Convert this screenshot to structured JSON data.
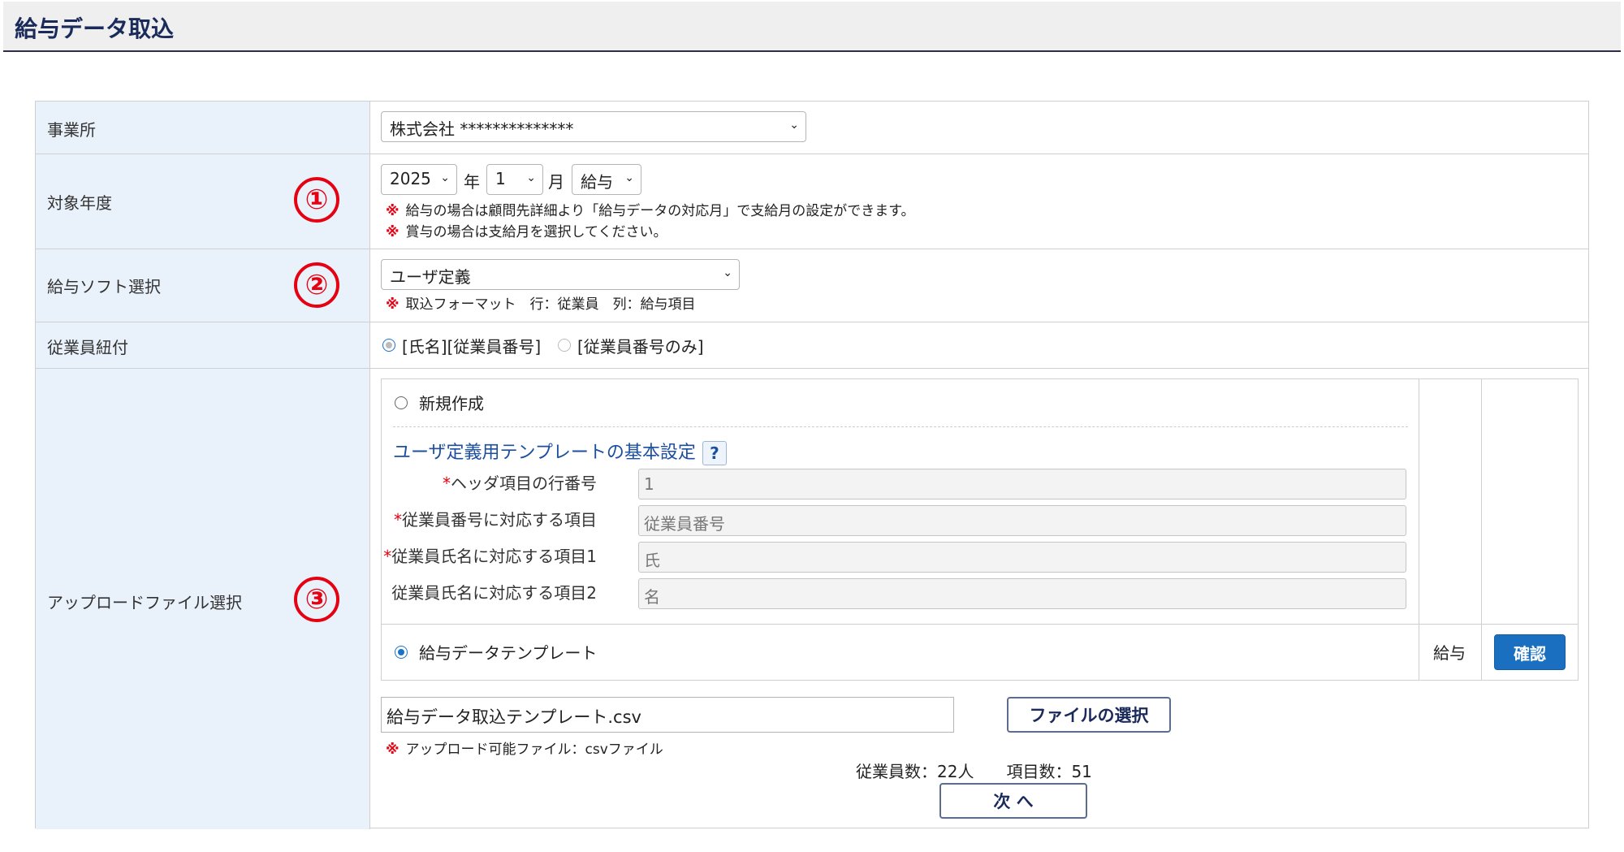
{
  "page": {
    "title": "給与データ取込"
  },
  "office": {
    "label": "事業所",
    "value": "株式会社 **************"
  },
  "year": {
    "label": "対象年度",
    "marker": "①",
    "year_value": "2025",
    "year_unit": "年",
    "month_value": "1",
    "month_unit": "月",
    "type_value": "給与",
    "notes": [
      "給与の場合は顧問先詳細より「給与データの対応月」で支給月の設定ができます。",
      "賞与の場合は支給月を選択してください。"
    ],
    "note_mark": "※"
  },
  "software": {
    "label": "給与ソフト選択",
    "marker": "②",
    "value": "ユーザ定義",
    "note": "取込フォーマット　行：従業員　列：給与項目",
    "note_mark": "※"
  },
  "employee_link": {
    "label": "従業員紐付",
    "option1": "[氏名][従業員番号]",
    "option2": "[従業員番号のみ]"
  },
  "upload": {
    "label": "アップロードファイル選択",
    "marker": "③",
    "new_label": "新規作成",
    "template_section_title": "ユーザ定義用テンプレートの基本設定",
    "help_label": "?",
    "required_mark": "*",
    "fields": [
      {
        "label": "ヘッダ項目の行番号",
        "value": "1",
        "required": true
      },
      {
        "label": "従業員番号に対応する項目",
        "value": "従業員番号",
        "required": true
      },
      {
        "label": "従業員氏名に対応する項目1",
        "value": "氏",
        "required": true
      },
      {
        "label": "従業員氏名に対応する項目2",
        "value": "名",
        "required": false
      }
    ],
    "template_label": "給与データテンプレート",
    "template_type": "給与",
    "confirm_button": "確認",
    "file_name": "給与データ取込テンプレート.csv",
    "file_button": "ファイルの選択",
    "file_note": "アップロード可能ファイル：csvファイル",
    "note_mark": "※",
    "counts": "従業員数：22人　　項目数：51",
    "next_button": "次 へ"
  }
}
